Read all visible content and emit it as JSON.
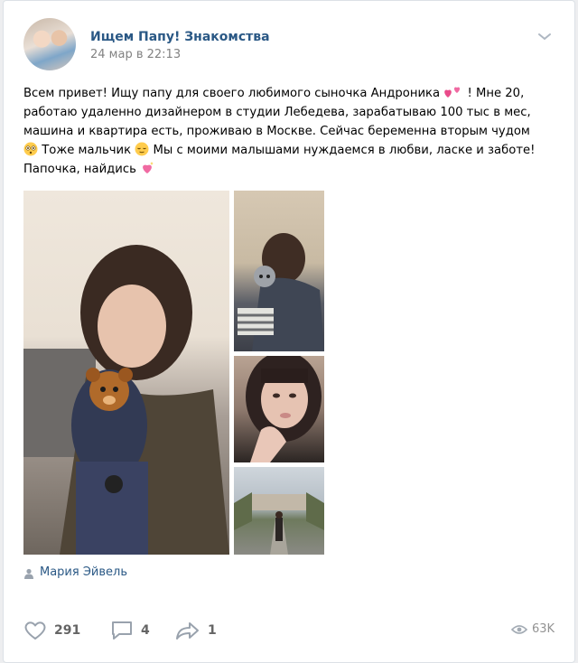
{
  "post": {
    "group_name": "Ищем Папу! Знакомства",
    "date": "24 мар в 22:13",
    "text_lines": [
      "Всем привет! Ищу папу для своего любимого сыночка Андроника",
      "! Мне 20,",
      "работаю удаленно дизайнером в студии Лебедева, зарабатываю 100 тыс в мес,",
      "машина и квартира есть, проживаю в Москве. Сейчас беременна вторым чудом",
      "Тоже мальчик",
      "Мы с моими малышами нуждаемся в любви, ласке и заботе!",
      "Папочка, найдись"
    ],
    "emojis": [
      "two-hearts-icon",
      "flushed-face-icon",
      "relieved-face-icon",
      "sparkling-heart-icon"
    ],
    "author": "Мария Эйвель"
  },
  "actions": {
    "likes": "291",
    "comments": "4",
    "shares": "1",
    "views": "63K"
  },
  "colors": {
    "link": "#2a5885",
    "muted": "#828282",
    "icon": "#99a2ad"
  }
}
